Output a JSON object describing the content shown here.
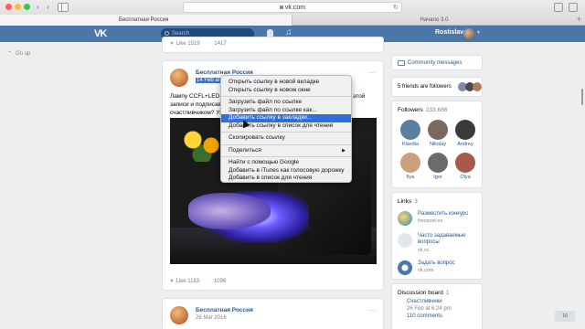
{
  "browser": {
    "url": "vk.com",
    "tabs": [
      "Бесплатная Россия",
      "Начало 3.0"
    ]
  },
  "vk": {
    "search_placeholder": "Search",
    "username": "Rostislav",
    "go_up": "Go up"
  },
  "top_post": {
    "likes": "Like 1519",
    "shares": "1417"
  },
  "post": {
    "author": "Бесплатная Россия",
    "date": "14 Feb at 6:00",
    "text_lines": [
      "Лампу CCFL+LED 36...",
      "записи и подписавш...",
      "счастливчиком? Уз..."
    ],
    "text_right": "ст этой",
    "likes": "Like 1183",
    "shares": "1096"
  },
  "post2": {
    "author": "Бесплатная Россия",
    "date": "26 Mar 2016"
  },
  "context_menu": {
    "items": [
      "Открыть ссылку в новой вкладке",
      "Открыть ссылку в новом окне",
      "Загрузить файл по ссылке",
      "Загрузить файл по ссылке как...",
      "Добавить ссылку в закладки...",
      "Добавить ссылку в список для чтения",
      "Скопировать ссылку",
      "Поделиться",
      "Найти с помощью Google",
      "Добавить в iTunes как голосовую дорожку",
      "Добавить в список для чтения"
    ],
    "selected_index": 4
  },
  "right": {
    "community_messages": "Community messages",
    "friends_followers": "5 friends are followers",
    "followers_title": "Followers",
    "followers_count": "233,686",
    "followers": [
      {
        "name": "Klavdia",
        "color": "#5a7fa1"
      },
      {
        "name": "Nikolay",
        "color": "#7a6a5e"
      },
      {
        "name": "Andrey",
        "color": "#3a3a3a"
      },
      {
        "name": "Ilya",
        "color": "#c9a07a"
      },
      {
        "name": "Igor",
        "color": "#6b6b6b"
      },
      {
        "name": "Olya",
        "color": "#a55a4a"
      }
    ],
    "links_title": "Links",
    "links_count": "3",
    "links": [
      {
        "title": "Разместить конкурс",
        "sub": "freepost.es"
      },
      {
        "title": "Часто задаваемые вопросы",
        "sub": "vk.cc"
      },
      {
        "title": "Задать вопрос",
        "sub": "vk.com"
      }
    ],
    "discussion_title": "Discussion board",
    "discussion_count": "1",
    "discussion_topic": "Счастливчики",
    "discussion_date": "26 Feb at 6:24 pm",
    "discussion_comments": "110 comments",
    "bubble": "16"
  }
}
